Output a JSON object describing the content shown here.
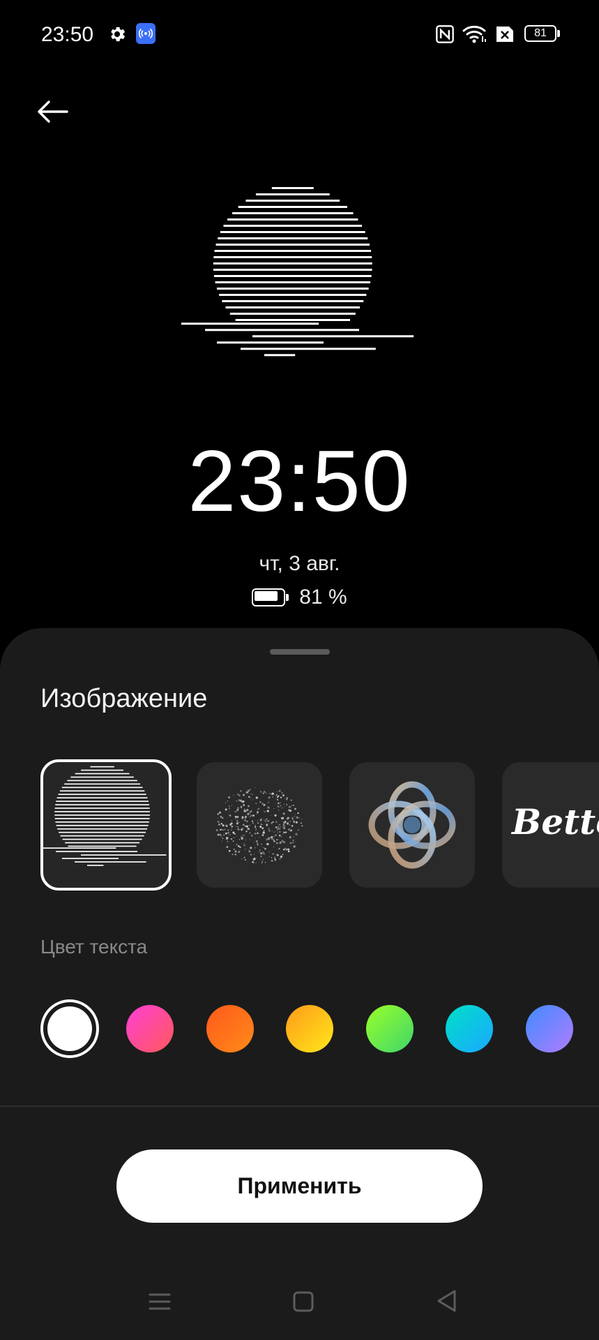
{
  "status_bar": {
    "time": "23:50",
    "battery": "81"
  },
  "preview": {
    "time": "23:50",
    "date": "чт, 3 авг.",
    "battery_text": "81 %",
    "battery_level": 0.81
  },
  "sheet": {
    "title": "Изображение",
    "images": [
      {
        "name": "sunset-lines",
        "selected": true
      },
      {
        "name": "dot-sphere",
        "selected": false
      },
      {
        "name": "glass-knot",
        "selected": false
      },
      {
        "name": "script-text",
        "text": "Bette",
        "selected": false
      }
    ],
    "color_label": "Цвет текста",
    "colors": [
      {
        "name": "white",
        "fill": "#ffffff",
        "selected": true
      },
      {
        "name": "pink",
        "gradient": [
          "#ff3fd6",
          "#ff5a5a"
        ]
      },
      {
        "name": "orange",
        "gradient": [
          "#ff5a1a",
          "#ff8a1a"
        ]
      },
      {
        "name": "yellow",
        "gradient": [
          "#ff9a1a",
          "#ffe81a"
        ]
      },
      {
        "name": "lime",
        "gradient": [
          "#9aff2a",
          "#3fd66a"
        ]
      },
      {
        "name": "cyan",
        "gradient": [
          "#00e0c8",
          "#1aa8ff"
        ]
      },
      {
        "name": "blue",
        "gradient": [
          "#3f8cff",
          "#b07cff"
        ]
      }
    ],
    "apply_label": "Применить"
  },
  "icons": {
    "back": "arrow-left-icon",
    "settings": "gear-icon",
    "hotspot": "hotspot-icon",
    "nfc": "nfc-icon",
    "wifi": "wifi-icon",
    "sim": "sim-off-icon",
    "nav_menu": "menu-icon",
    "nav_home": "home-square-icon",
    "nav_back": "back-triangle-icon"
  }
}
